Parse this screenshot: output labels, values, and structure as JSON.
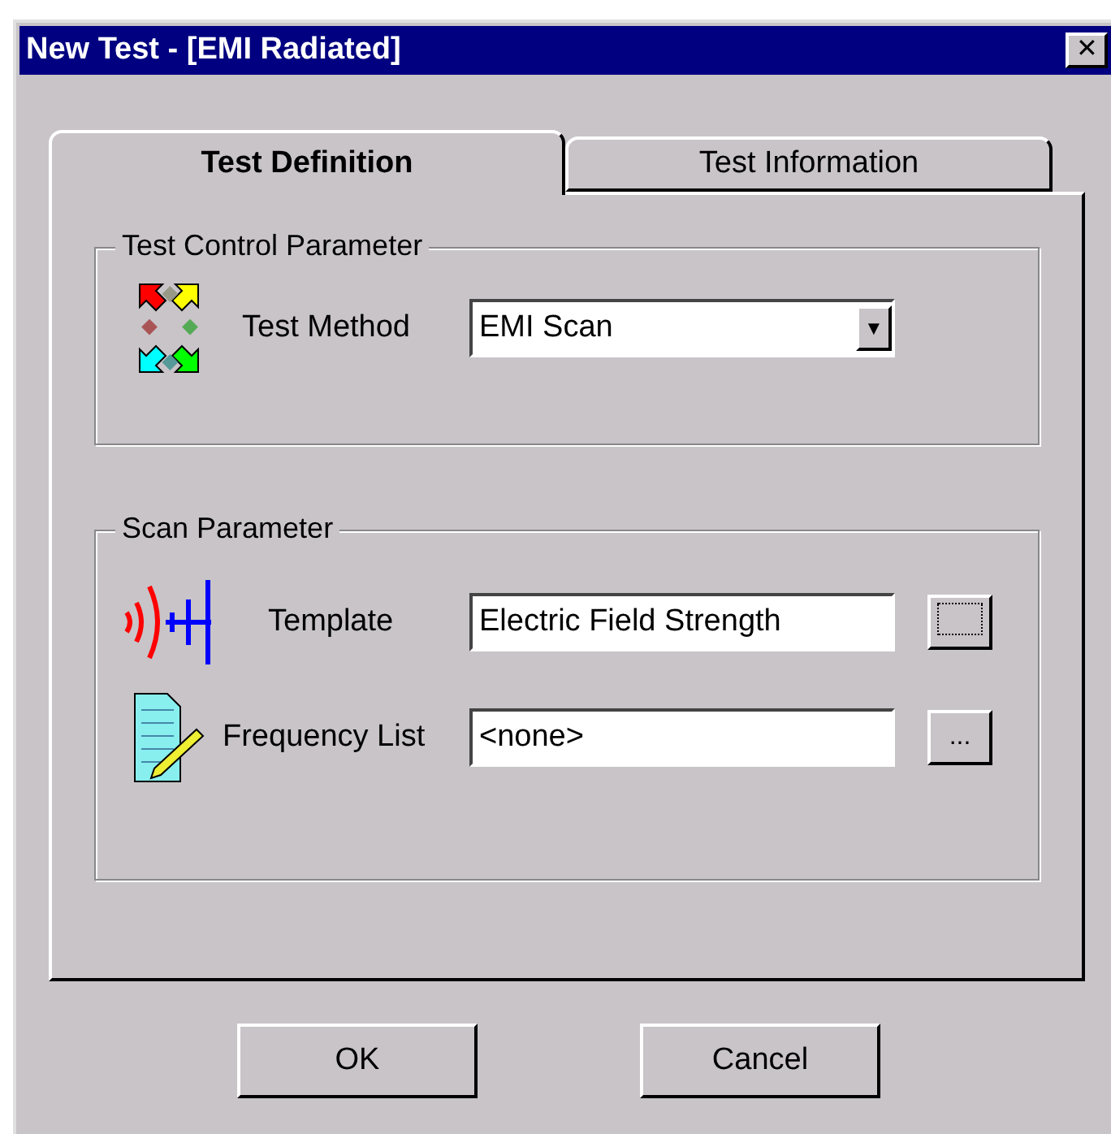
{
  "window": {
    "title": "New Test - [EMI Radiated]",
    "close": "✕"
  },
  "tabs": [
    {
      "label": "Test Definition",
      "selected": true
    },
    {
      "label": "Test Information",
      "selected": false
    }
  ],
  "groups": [
    {
      "title": "Test Control Parameter",
      "rows": [
        {
          "kind": "dropdown",
          "label": "Test Method",
          "value": "EMI Scan",
          "arrow": "▼"
        }
      ]
    },
    {
      "title": "Scan Parameter",
      "rows": [
        {
          "kind": "browse",
          "label": "Template",
          "value": "Electric Field Strength",
          "button": {
            "focused": true
          }
        },
        {
          "kind": "browse",
          "label": "Frequency List",
          "value": "<none>",
          "button": {
            "label": "...",
            "focused": false
          }
        }
      ]
    }
  ],
  "buttons": [
    "OK",
    "Cancel"
  ]
}
